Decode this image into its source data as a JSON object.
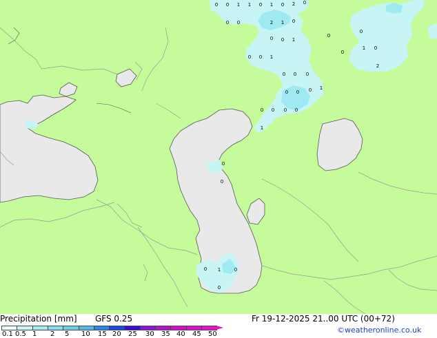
{
  "map": {
    "colors": {
      "land": "#c6fb9c",
      "water": "#e9e9e9",
      "precip_light": "#c7f5f6",
      "precip_mid": "#9ee9f2",
      "precip_heavy": "#7edaed",
      "border": "#999999",
      "coast": "#555555"
    },
    "precip_labels": [
      "0",
      "0",
      "1",
      "1",
      "0",
      "1",
      "2",
      "0",
      "0",
      "0",
      "0",
      "2",
      "1",
      "0",
      "0",
      "0",
      "1",
      "0",
      "1",
      "0",
      "0",
      "0",
      "0",
      "0",
      "0",
      "0",
      "0",
      "0",
      "0",
      "0",
      "1",
      "1",
      "0",
      "0",
      "0",
      "1",
      "0",
      "0",
      "0",
      "0",
      "0",
      "1",
      "0",
      "2"
    ]
  },
  "footer": {
    "title": "Precipitation [mm]",
    "model": "GFS 0.25",
    "datetime": "Fr 19-12-2025 21..00 UTC (00+72)",
    "credit": "©weatheronline.co.uk",
    "legend": {
      "labels": [
        "0.1",
        "0.5",
        "1",
        "2",
        "5",
        "10",
        "15",
        "20",
        "25",
        "30",
        "35",
        "40",
        "45",
        "50"
      ],
      "colors": [
        "#e6ffff",
        "#c8f5fa",
        "#a6ecf5",
        "#8adcf0",
        "#6fcfe8",
        "#58b9e4",
        "#2f86ea",
        "#1d49e0",
        "#3a0cdc",
        "#8a16d8",
        "#b412d2",
        "#d40fcc",
        "#e00fd0",
        "#e612cc"
      ]
    }
  }
}
